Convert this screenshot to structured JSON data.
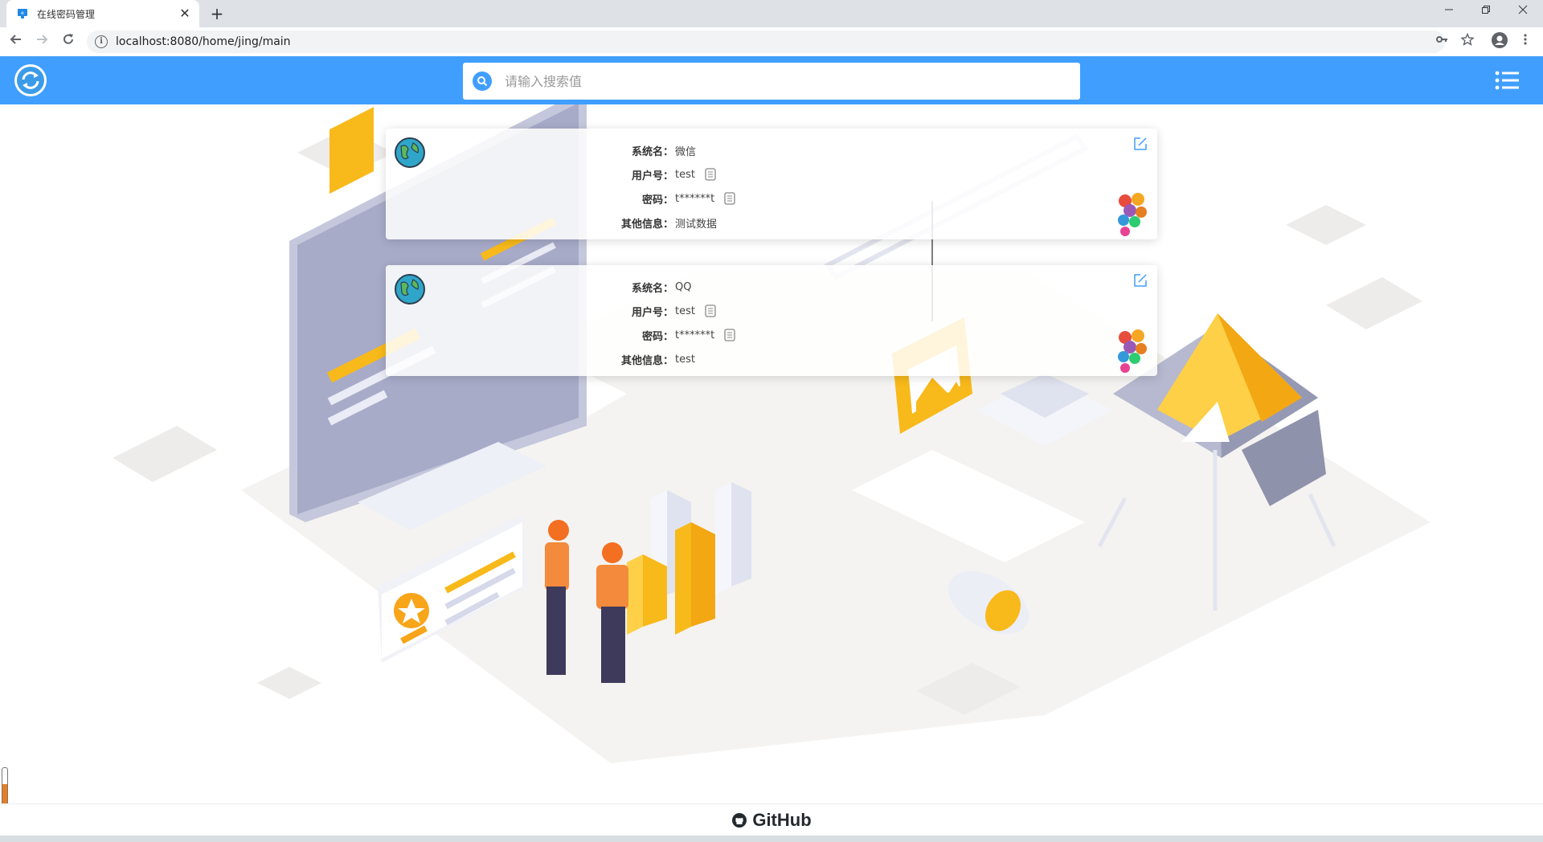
{
  "browser": {
    "tab_title": "在线密码管理",
    "url": "localhost:8080/home/jing/main",
    "new_tab_symbol": "+",
    "close_symbol": "✕"
  },
  "header": {
    "search_placeholder": "请输入搜索值"
  },
  "cards": [
    {
      "labels": {
        "system": "系统名：",
        "user": "用户号：",
        "password": "密码：",
        "other": "其他信息："
      },
      "system": "微信",
      "user": "test",
      "password": "t******t",
      "other": "测试数据"
    },
    {
      "labels": {
        "system": "系统名：",
        "user": "用户号：",
        "password": "密码：",
        "other": "其他信息："
      },
      "system": "QQ",
      "user": "test",
      "password": "t******t",
      "other": "test"
    }
  ],
  "footer": {
    "brand": "GitHub"
  },
  "colors": {
    "header": "#409eff",
    "tabstrip": "#dee1e6",
    "accent_yellow": "#fbc02d"
  }
}
